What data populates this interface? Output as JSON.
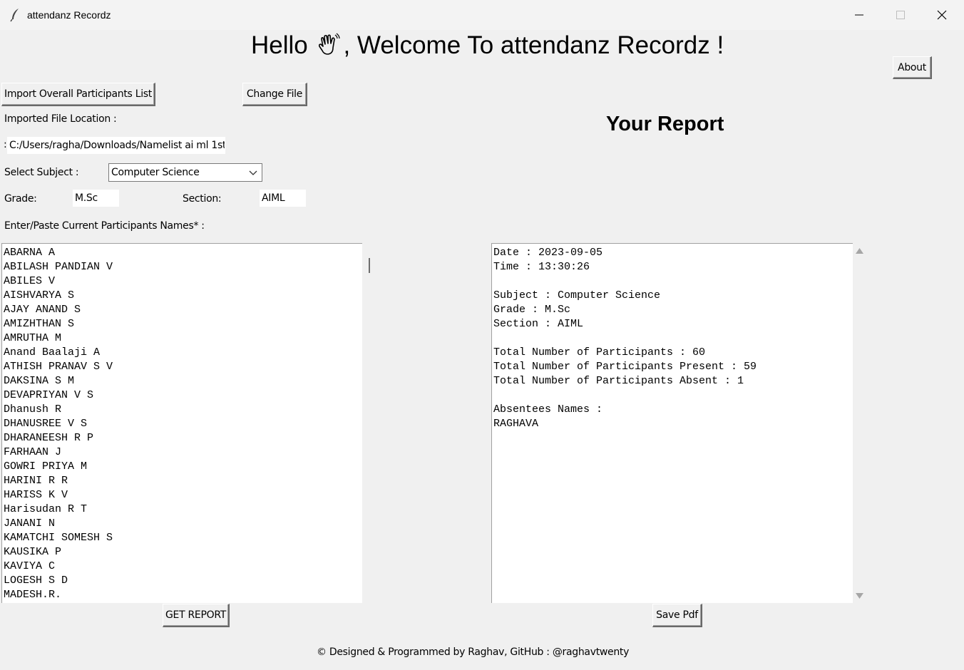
{
  "window": {
    "title": "attendanz Recordz",
    "controls": {
      "minimize_icon": "minimize-icon",
      "maximize_icon": "maximize-icon",
      "close_icon": "close-icon"
    }
  },
  "header": {
    "greeting_start": "Hello ",
    "greeting_icon": "waving-hand-icon",
    "greeting_end": ", Welcome To attendanz Recordz !"
  },
  "buttons": {
    "about": "About",
    "import": "Import Overall Participants List",
    "change_file": "Change File",
    "get_report": "GET REPORT",
    "save_pdf": "Save Pdf"
  },
  "form": {
    "file_location_label": "Imported File Location :",
    "file_prefix": ":",
    "file_path": "C:/Users/ragha/Downloads/Namelist ai ml 1st",
    "subject_label": "Select Subject :",
    "subject_value": "Computer Science",
    "grade_label": "Grade:",
    "grade_value": "M.Sc",
    "section_label": "Section:",
    "section_value": "AIML",
    "names_label": "Enter/Paste Current Participants Names* :"
  },
  "participants": [
    "ABARNA A",
    "ABILASH PANDIAN V",
    "ABILES V",
    "AISHVARYA S",
    "AJAY ANAND S",
    "AMIZHTHAN S",
    "AMRUTHA M",
    "Anand Baalaji A",
    "ATHISH PRANAV S V",
    "DAKSINA S M",
    "DEVAPRIYAN V S",
    "Dhanush R",
    "DHANUSREE V S",
    "DHARANEESH R P",
    "FARHAAN J",
    "GOWRI PRIYA M",
    "HARINI R R",
    "HARISS K V",
    "Harisudan R T",
    "JANANI N",
    "KAMATCHI SOMESH S",
    "KAUSIKA P",
    "KAVIYA C",
    "LOGESH S D",
    "MADESH.R."
  ],
  "report": {
    "title": "Your Report",
    "lines": [
      "Date : 2023-09-05",
      "Time : 13:30:26",
      "",
      "Subject : Computer Science",
      "Grade : M.Sc",
      "Section : AIML",
      "",
      "Total Number of Participants : 60",
      "Total Number of Participants Present : 59",
      "Total Number of Participants Absent : 1",
      "",
      "Absentees Names :",
      "RAGHAVA"
    ]
  },
  "footer": "© Designed & Programmed by Raghav, GitHub : @raghavtwenty"
}
